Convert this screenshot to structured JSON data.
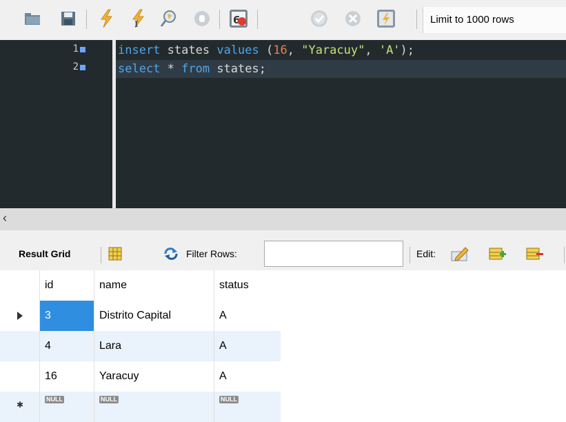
{
  "toolbar": {
    "icons": [
      "open-folder-icon",
      "save-icon",
      "execute-icon",
      "execute-current-icon",
      "explain-icon",
      "stop-icon",
      "toggle-error-icon",
      "commit-icon",
      "rollback-icon",
      "autocommit-icon"
    ],
    "limit_label": "Limit to 1000 rows"
  },
  "editor": {
    "lines": [
      {
        "number": "1",
        "tokens": [
          {
            "t": "insert",
            "c": "kw"
          },
          {
            "t": " "
          },
          {
            "t": "states",
            "c": "plain"
          },
          {
            "t": " "
          },
          {
            "t": "values",
            "c": "kw"
          },
          {
            "t": " ("
          },
          {
            "t": "16",
            "c": "num"
          },
          {
            "t": ", "
          },
          {
            "t": "\"Yaracuy\"",
            "c": "str"
          },
          {
            "t": ", "
          },
          {
            "t": "'A'",
            "c": "str"
          },
          {
            "t": ");"
          }
        ]
      },
      {
        "number": "2",
        "tokens": [
          {
            "t": "select",
            "c": "kw"
          },
          {
            "t": " * "
          },
          {
            "t": "from",
            "c": "kw"
          },
          {
            "t": " states;"
          }
        ]
      }
    ]
  },
  "result_toolbar": {
    "result_grid_label": "Result Grid",
    "filter_label": "Filter Rows:",
    "filter_value": "",
    "edit_label": "Edit:"
  },
  "grid": {
    "columns": [
      "id",
      "name",
      "status"
    ],
    "rows": [
      {
        "id": "3",
        "name": "Distrito Capital",
        "status": "A"
      },
      {
        "id": "4",
        "name": "Lara",
        "status": "A"
      },
      {
        "id": "16",
        "name": "Yaracuy",
        "status": "A"
      }
    ],
    "null_label": "NULL"
  },
  "colors": {
    "editor_bg": "#232a2e",
    "keyword": "#4fa7e8",
    "number": "#f07f4e",
    "string": "#c8e07a",
    "selection": "#2f8ee0"
  }
}
